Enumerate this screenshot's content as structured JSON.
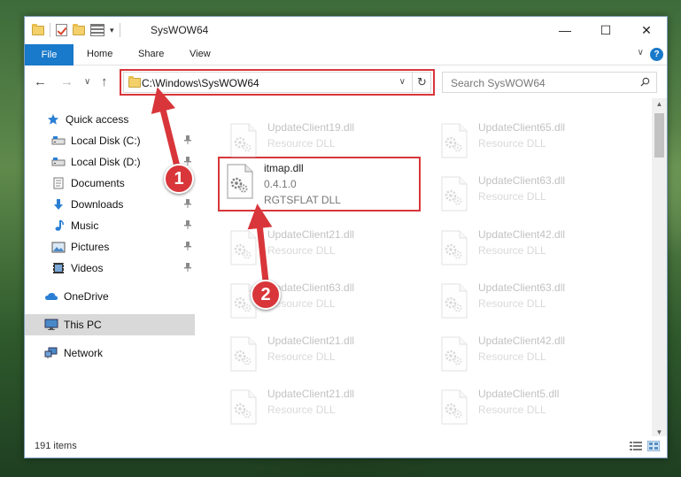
{
  "window": {
    "title": "SysWOW64",
    "controls": {
      "minimize": "—",
      "maximize": "☐",
      "close": "✕"
    }
  },
  "ribbon": {
    "file_tab": "File",
    "tabs": [
      "Home",
      "Share",
      "View"
    ],
    "help": "?",
    "toggle": "∨"
  },
  "navigation": {
    "back": "←",
    "forward": "→",
    "recent": "∨",
    "up": "↑",
    "address": "C:\\Windows\\SysWOW64",
    "address_dropdown": "∨",
    "refresh": "↻",
    "search_placeholder": "Search SysWOW64"
  },
  "sidebar": {
    "items": [
      {
        "label": "Quick access",
        "icon": "star-icon",
        "pinned": false
      },
      {
        "label": "Local Disk (C:)",
        "icon": "drive-icon",
        "pinned": true
      },
      {
        "label": "Local Disk (D:)",
        "icon": "drive-icon",
        "pinned": true
      },
      {
        "label": "Documents",
        "icon": "documents-icon",
        "pinned": true
      },
      {
        "label": "Downloads",
        "icon": "download-icon",
        "pinned": true
      },
      {
        "label": "Music",
        "icon": "music-icon",
        "pinned": true
      },
      {
        "label": "Pictures",
        "icon": "pictures-icon",
        "pinned": true
      },
      {
        "label": "Videos",
        "icon": "videos-icon",
        "pinned": true
      },
      {
        "label": "OneDrive",
        "icon": "cloud-icon",
        "pinned": false
      },
      {
        "label": "This PC",
        "icon": "computer-icon",
        "pinned": false,
        "selected": true
      },
      {
        "label": "Network",
        "icon": "network-icon",
        "pinned": false
      }
    ],
    "pin_glyph": "📌"
  },
  "files": {
    "highlighted": {
      "name": "itmap.dll",
      "version": "0.4.1.0",
      "description": "RGTSFLAT DLL"
    },
    "left_column": [
      {
        "name": "UpdateClient19.dll",
        "description": "Resource DLL"
      },
      {
        "name": "UpdateClient21.dll",
        "description": "Resource DLL"
      },
      {
        "name": "UpdateClient63.dll",
        "description": "Resource DLL"
      },
      {
        "name": "UpdateClient21.dll",
        "description": "Resource DLL"
      },
      {
        "name": "UpdateClient21.dll",
        "description": "Resource DLL"
      }
    ],
    "right_column": [
      {
        "name": "UpdateClient65.dll",
        "description": "Resource DLL"
      },
      {
        "name": "UpdateClient63.dll",
        "description": "Resource DLL"
      },
      {
        "name": "UpdateClient42.dll",
        "description": "Resource DLL"
      },
      {
        "name": "UpdateClient63.dll",
        "description": "Resource DLL"
      },
      {
        "name": "UpdateClient42.dll",
        "description": "Resource DLL"
      },
      {
        "name": "UpdateClient5.dll",
        "description": "Resource DLL"
      }
    ]
  },
  "status": {
    "item_count": "191 items"
  },
  "annotations": {
    "step1": "1",
    "step2": "2",
    "color": "#d8363a"
  },
  "colors": {
    "accent": "#1979ca",
    "highlight": "#d8363a",
    "selected": "#d9d9d9"
  }
}
